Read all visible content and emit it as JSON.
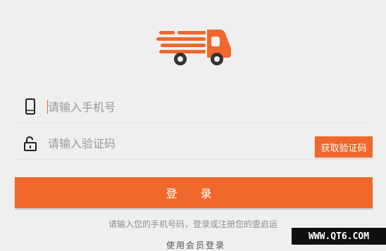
{
  "app": {
    "logo_icon": "delivery-truck-icon",
    "accent_color": "#f0682b"
  },
  "form": {
    "phone_placeholder": "请输入手机号",
    "phone_icon": "mobile-phone-icon",
    "code_placeholder": "请输入验证码",
    "code_icon": "unlock-icon",
    "get_code_label": "获取验证码",
    "login_label": "登 录"
  },
  "hint_text": "请输入您的手机号码，登录或注册您的壹启运",
  "bottom_link": "使用会员登录",
  "watermark": "WWW.QT6.COM"
}
